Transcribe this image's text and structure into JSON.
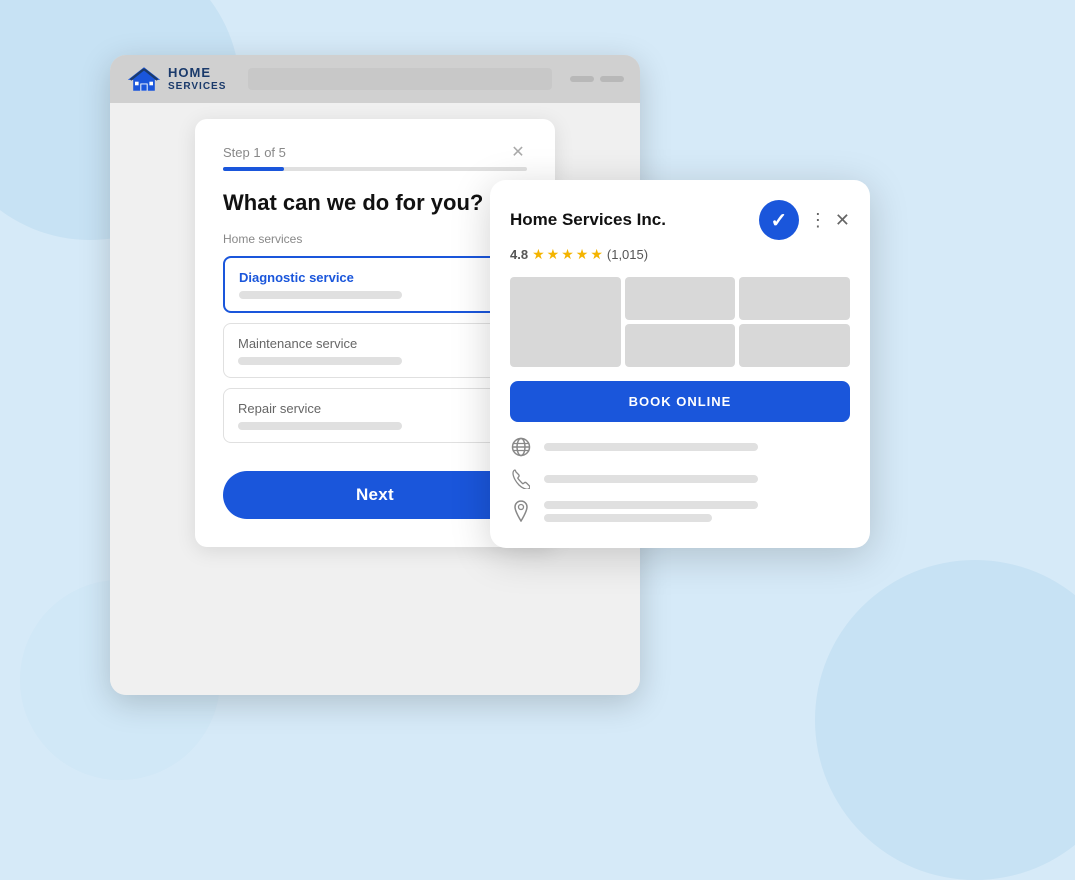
{
  "background": {
    "color": "#d6eaf8"
  },
  "browser": {
    "logo": {
      "name": "HOME\nSERVICES",
      "home_text": "HOME",
      "services_text": "SERVICES"
    }
  },
  "form": {
    "step_label": "Step 1 of 5",
    "progress_percent": 20,
    "question": "What can we do for you?",
    "section_label": "Home services",
    "close_label": "✕",
    "services": [
      {
        "id": "diagnostic",
        "title": "Diagnostic service",
        "selected": true
      },
      {
        "id": "maintenance",
        "title": "Maintenance service",
        "selected": false
      },
      {
        "id": "repair",
        "title": "Repair service",
        "selected": false
      }
    ],
    "next_button_label": "Next"
  },
  "business_card": {
    "name": "Home Services Inc.",
    "rating": "4.8",
    "review_count": "(1,015)",
    "book_button_label": "BOOK ONLINE",
    "close_label": "✕",
    "menu_label": "⋮",
    "verified": true,
    "info_rows": [
      {
        "icon_type": "globe"
      },
      {
        "icon_type": "phone"
      },
      {
        "icon_type": "location"
      }
    ]
  },
  "icons": {
    "close": "✕",
    "menu": "⋮",
    "check": "✓",
    "globe": "🌐",
    "phone": "📞",
    "location": "📍"
  }
}
